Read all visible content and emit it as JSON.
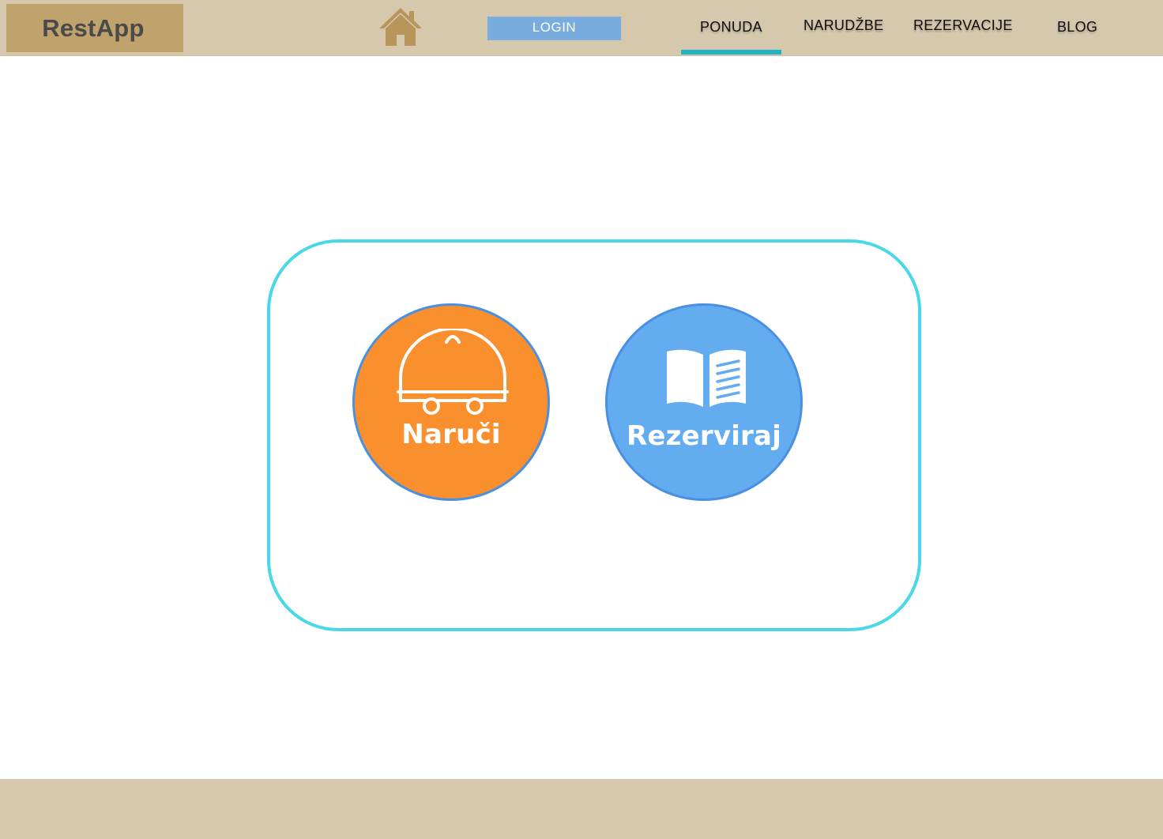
{
  "header": {
    "logo_text": "RestApp",
    "login_label": "LOGIN",
    "nav": {
      "ponuda": "PONUDA",
      "narudzbe": "NARUDŽBE",
      "rezervacije": "REZERVACIJE",
      "blog": "BLOG"
    },
    "active_nav": "PONUDA"
  },
  "main": {
    "actions": [
      {
        "label": "Naruči",
        "icon": "food-delivery-cloche-icon",
        "color": "#fa8f2e"
      },
      {
        "label": "Rezerviraj",
        "icon": "open-book-icon",
        "color": "#63acf0"
      }
    ]
  },
  "colors": {
    "header_bg": "#d6c8ad",
    "logo_bg": "#c0a36c",
    "login_bg": "#7aaddf",
    "active_underline": "#22b3c8",
    "panel_border": "#48d8e6",
    "circle_border": "#4a90e2",
    "footer_bg": "#d6c8ad"
  }
}
